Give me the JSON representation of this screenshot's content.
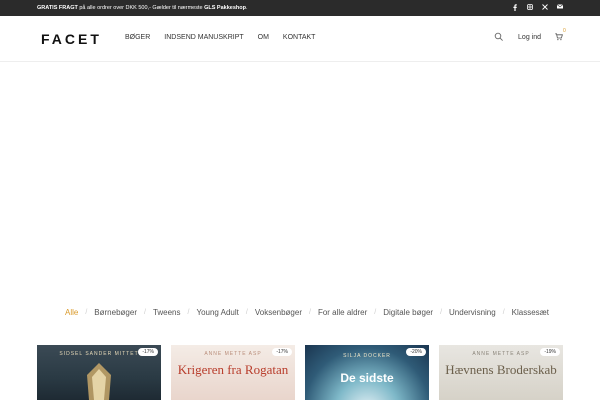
{
  "topbar": {
    "promo_bold": "GRATIS FRAGT",
    "promo_text": " på alle ordrer over DKK 500,- Gælder til nærmeste ",
    "promo_bold2": "GLS Pakkeshop",
    "promo_end": ".",
    "social_icons": [
      "facebook-icon",
      "instagram-icon",
      "x-icon",
      "mail-icon"
    ]
  },
  "header": {
    "logo": "FACET",
    "nav": [
      "BØGER",
      "INDSEND MANUSKRIPT",
      "OM",
      "KONTAKT"
    ],
    "login": "Log ind",
    "cart_count": "0"
  },
  "categories": {
    "items": [
      "Alle",
      "Børnebøger",
      "Tweens",
      "Young Adult",
      "Voksenbøger",
      "For alle aldrer",
      "Digitale bøger",
      "Undervisning",
      "Klassesæt"
    ],
    "active": "Alle",
    "accent_color": "#d99a2b"
  },
  "products": [
    {
      "author": "SIDSEL SANDER MITTET",
      "title": "",
      "discount": "-17%"
    },
    {
      "author": "ANNE METTE ASP",
      "title": "Krigeren fra Rogatan",
      "discount": "-17%"
    },
    {
      "author": "SILJA DOCKER",
      "title": "De sidste",
      "discount": "-20%"
    },
    {
      "author": "ANNE METTE ASP",
      "title": "Hævnens Broderskab",
      "discount": "-19%"
    }
  ]
}
